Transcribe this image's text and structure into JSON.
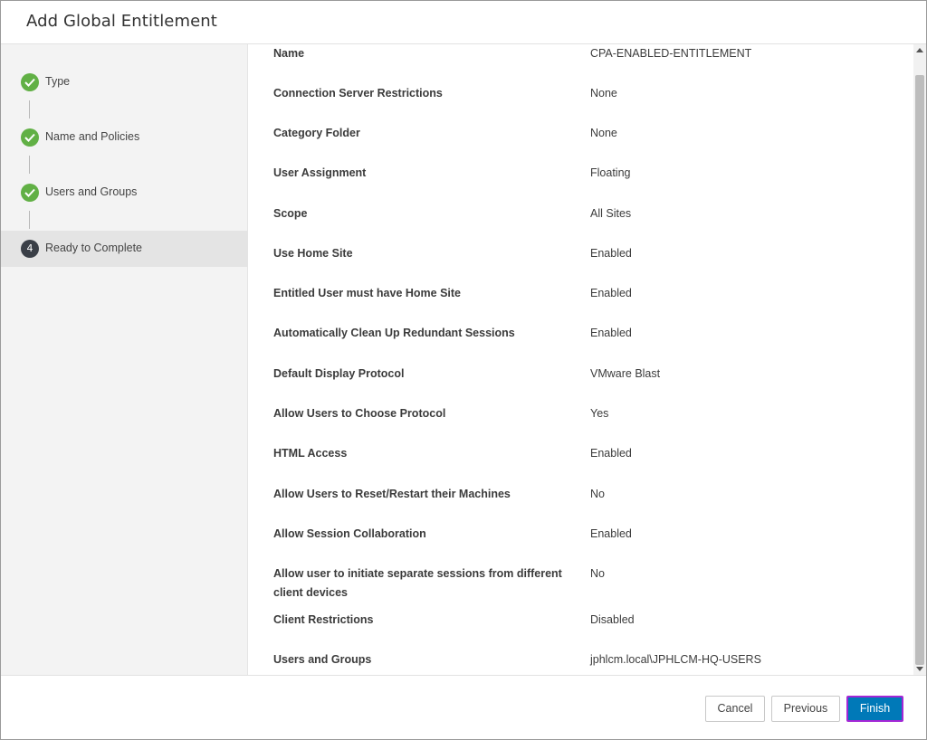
{
  "dialog": {
    "title": "Add Global Entitlement"
  },
  "steps": [
    {
      "label": "Type",
      "status": "done"
    },
    {
      "label": "Name and Policies",
      "status": "done"
    },
    {
      "label": "Users and Groups",
      "status": "done"
    },
    {
      "label": "Ready to Complete",
      "status": "active",
      "number": "4"
    }
  ],
  "summary": [
    {
      "label": "Name",
      "value": "CPA-ENABLED-ENTITLEMENT"
    },
    {
      "label": "Connection Server Restrictions",
      "value": "None"
    },
    {
      "label": "Category Folder",
      "value": "None"
    },
    {
      "label": "User Assignment",
      "value": "Floating"
    },
    {
      "label": "Scope",
      "value": "All Sites"
    },
    {
      "label": "Use Home Site",
      "value": "Enabled"
    },
    {
      "label": "Entitled User must have Home Site",
      "value": "Enabled"
    },
    {
      "label": "Automatically Clean Up Redundant Sessions",
      "value": "Enabled"
    },
    {
      "label": "Default Display Protocol",
      "value": "VMware Blast"
    },
    {
      "label": "Allow Users to Choose Protocol",
      "value": "Yes"
    },
    {
      "label": "HTML Access",
      "value": "Enabled"
    },
    {
      "label": "Allow Users to Reset/Restart their Machines",
      "value": "No"
    },
    {
      "label": "Allow Session Collaboration",
      "value": "Enabled"
    },
    {
      "label": "Allow user to initiate separate sessions from different client devices",
      "value": "No"
    },
    {
      "label": "Client Restrictions",
      "value": "Disabled"
    },
    {
      "label": "Users and Groups",
      "value": "jphlcm.local\\JPHLCM-HQ-USERS"
    }
  ],
  "footer": {
    "cancel_label": "Cancel",
    "previous_label": "Previous",
    "finish_label": "Finish"
  },
  "colors": {
    "step_done": "#61b045",
    "step_active": "#3a3f47",
    "finish_button": "#0079b8",
    "finish_focus_ring": "#a326d6"
  },
  "icons": {
    "step_done": "checkmark-icon",
    "scroll_up": "arrow-up-icon",
    "scroll_down": "arrow-down-icon"
  }
}
